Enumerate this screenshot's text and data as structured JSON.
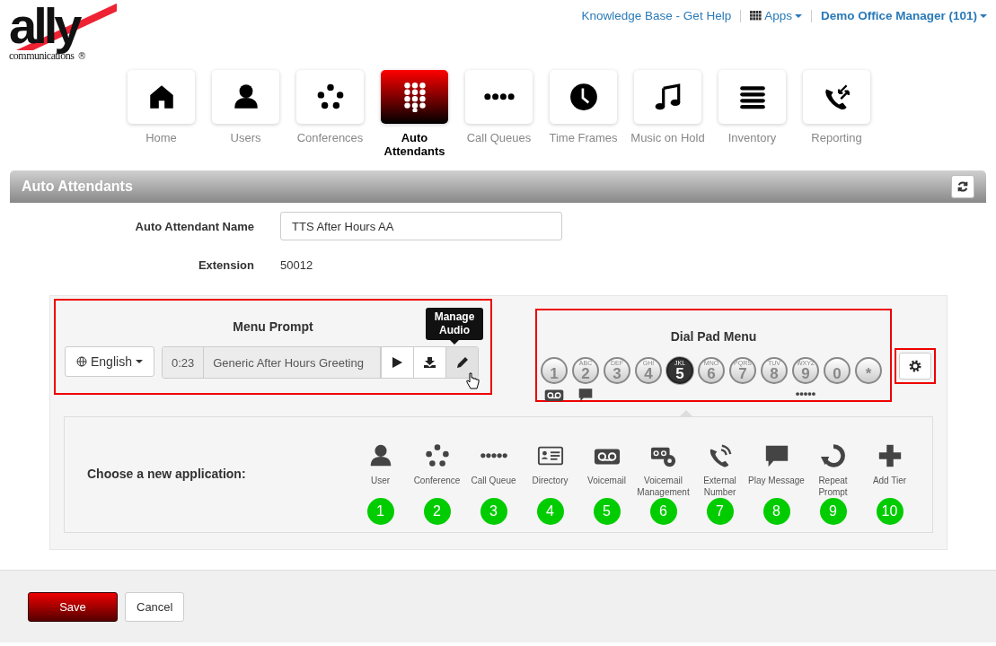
{
  "logo": {
    "wordmark": "ally",
    "tagline": "communications",
    "mark": "®"
  },
  "top_links": [
    {
      "kind": "link",
      "label": "Knowledge Base - Get Help"
    },
    {
      "kind": "apps",
      "label": "Apps"
    },
    {
      "kind": "user",
      "label": "Demo Office Manager (101)"
    }
  ],
  "nav": [
    {
      "kind": "home",
      "label": "Home",
      "selected": false
    },
    {
      "kind": "user",
      "label": "Users",
      "selected": false
    },
    {
      "kind": "conference",
      "label": "Conferences",
      "selected": false
    },
    {
      "kind": "keypad",
      "label": "Auto Attendants",
      "selected": true
    },
    {
      "kind": "dots",
      "label": "Call Queues",
      "selected": false
    },
    {
      "kind": "clock",
      "label": "Time Frames",
      "selected": false
    },
    {
      "kind": "music",
      "label": "Music on Hold",
      "selected": false
    },
    {
      "kind": "list",
      "label": "Inventory",
      "selected": false
    },
    {
      "kind": "reporting",
      "label": "Reporting",
      "selected": false
    }
  ],
  "section_title": "Auto Attendants",
  "form": [
    {
      "kind": "input",
      "label": "Auto Attendant Name",
      "value": "TTS After Hours AA"
    },
    {
      "kind": "text",
      "label": "Extension",
      "value": "50012"
    }
  ],
  "menu_prompt": {
    "title": "Menu Prompt",
    "highlighted": true,
    "language": "English",
    "duration": "0:23",
    "prompt_name": "Generic After Hours Greeting",
    "tooltip": "Manage Audio"
  },
  "dial_pad": {
    "title": "Dial Pad Menu",
    "highlighted": true,
    "settings_highlighted": true,
    "keys": [
      {
        "digit": "1",
        "selected": false,
        "kind": "voicemail"
      },
      {
        "digit": "2",
        "letters": "ABC",
        "selected": false,
        "kind": "message"
      },
      {
        "digit": "3",
        "letters": "DEF",
        "selected": false,
        "kind": "empty"
      },
      {
        "digit": "4",
        "letters": "GHI",
        "selected": false,
        "kind": "empty"
      },
      {
        "digit": "5",
        "letters": "JKL",
        "selected": true,
        "kind": "empty"
      },
      {
        "digit": "6",
        "letters": "MNO",
        "selected": false,
        "kind": "empty"
      },
      {
        "digit": "7",
        "letters": "PQRS",
        "selected": false,
        "kind": "empty"
      },
      {
        "digit": "8",
        "letters": "TUV",
        "selected": false,
        "kind": "empty"
      },
      {
        "digit": "9",
        "letters": "WXYZ",
        "selected": false,
        "kind": "queue"
      },
      {
        "digit": "0",
        "selected": false,
        "kind": "empty"
      },
      {
        "digit": "*",
        "selected": false,
        "kind": "empty"
      }
    ]
  },
  "applications": {
    "prompt": "Choose a new application:",
    "items": [
      {
        "kind": "user",
        "label": "User",
        "number": "1"
      },
      {
        "kind": "conference",
        "label": "Conference",
        "number": "2"
      },
      {
        "kind": "queue",
        "label": "Call Queue",
        "number": "3"
      },
      {
        "kind": "directory",
        "label": "Directory",
        "number": "4"
      },
      {
        "kind": "voicemail",
        "label": "Voicemail",
        "number": "5"
      },
      {
        "kind": "management",
        "label": "Voicemail Management",
        "number": "6"
      },
      {
        "kind": "phone",
        "label": "External Number",
        "number": "7"
      },
      {
        "kind": "message",
        "label": "Play Message",
        "number": "8"
      },
      {
        "kind": "repeat",
        "label": "Repeat Prompt",
        "number": "9"
      },
      {
        "kind": "plus",
        "label": "Add Tier",
        "number": "10"
      }
    ]
  },
  "buttons": [
    {
      "kind": "primary",
      "label": "Save"
    },
    {
      "kind": "secondary",
      "label": "Cancel"
    }
  ]
}
